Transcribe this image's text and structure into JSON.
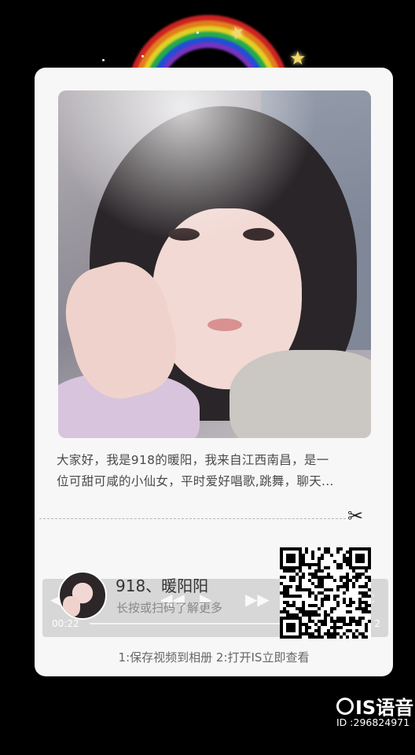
{
  "card": {
    "description_line1": "大家好，我是918的暖阳，我来自江西南昌，是一",
    "description_line2": "位可甜可咸的小仙女，平时爱好唱歌,跳舞，聊天...",
    "username": "918、暖阳阳",
    "hint": "长按或扫码了解更多",
    "footer": "1:保存视频到相册 2:打开IS立即查看"
  },
  "player": {
    "current_time": "00:22",
    "duration_tail": "2"
  },
  "brand": {
    "logo_text": "IS语音",
    "user_id": "ID :296824971"
  },
  "icons": {
    "scissors": "scissors-icon",
    "volume": "volume-icon",
    "prev": "rewind-icon",
    "play": "play-icon",
    "next": "fast-forward-icon",
    "fullscreen": "fullscreen-icon",
    "qr": "qr-code"
  },
  "colors": {
    "background": "#000000",
    "card": "#f7f7f7",
    "text": "#4a4a4a"
  }
}
